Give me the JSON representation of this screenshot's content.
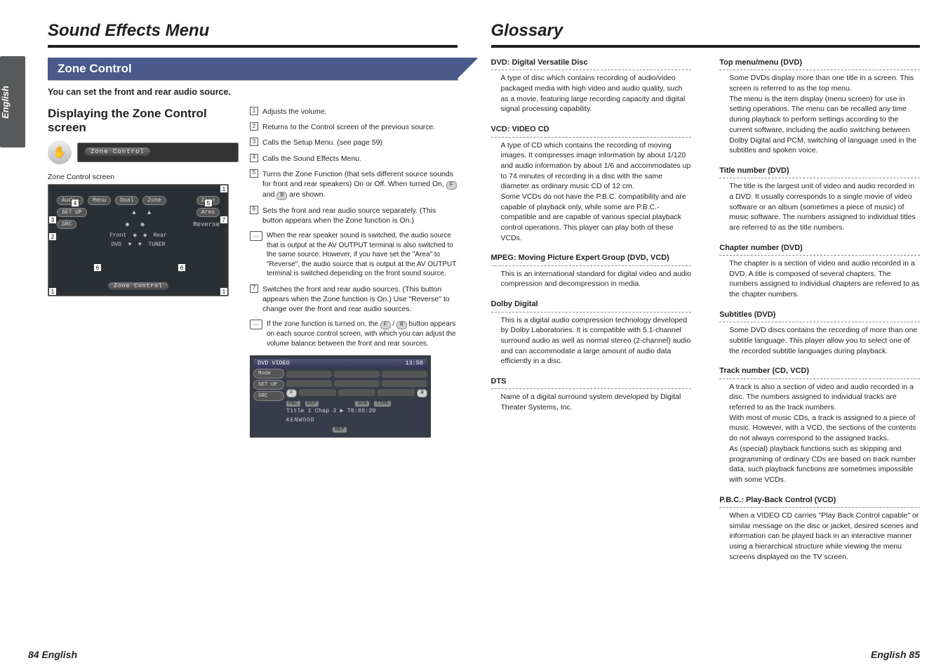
{
  "left": {
    "side_tab": "English",
    "title": "Sound Effects Menu",
    "section_banner": "Zone Control",
    "lead": "You can set the front and rear audio source.",
    "subheading": "Displaying the Zone Control screen",
    "small_screen_title": "Zone   Control",
    "screen_label": "Zone Control screen",
    "zc_screen": {
      "menu": "Menu",
      "dual": "Dual",
      "zone_lbl": "Zone",
      "zone_btn": "Zone",
      "area": "Area",
      "reverse": "Reverse",
      "front": "Front",
      "rear": "Rear",
      "dvd": "DVD",
      "tuner": "TUNER",
      "audio": "Audio",
      "setup_btn": "SET UP",
      "src_btn": "SRC",
      "footer": "Zone   Control"
    },
    "numbered": [
      "Adjusts the volume.",
      "Returns to the Control screen of the previous source.",
      "Calls the Setup Menu. (see page 59)",
      "Calls the Sound Effects Menu.",
      "Turns the Zone Function (that sets different source sounds for front and rear speakers) On or Off. When turned On, [F] and [R] are shown.",
      "Sets the front and rear audio source separately. (This button appears when the Zone function is On.)",
      "Switches the front and rear audio sources. (This button appears when the Zone function is On.) Use \"Reverse\" to change over the front and rear audio sources."
    ],
    "note6": "When the rear speaker sound is switched, the audio source that is output at the AV OUTPUT terminal is also switched to the same source. However, if you have set the \"Area\" to \"Reverse\", the audio source that is output at the AV OUTPUT terminal is switched depending on the front sound source.",
    "note7": "If the zone function is turned on, the [F] / [R] button appears on each source control screen, with which you can adjust the volume balance between the front and rear sources.",
    "dvd_screen": {
      "top_left": "DVD  VIDEO",
      "top_right": "13:50",
      "tags": [
        "PBC",
        "REP",
        "SCN",
        "TIME"
      ],
      "line": "Title 1    Chap    3   ▶   T0:05:20",
      "brand": "KENWOOD",
      "footer_tag": "REP",
      "side1": "Mode",
      "side2": "SET UP",
      "side3": "SRC"
    },
    "pagenum": "84 English"
  },
  "right": {
    "title": "Glossary",
    "col1": [
      {
        "term": "DVD: Digital Versatile Disc",
        "def": "A type of disc which contains recording of audio/video packaged media with high video and audio quality, such as a movie, featuring large recording capacity and digital signal processing capability."
      },
      {
        "term": "VCD: VIDEO CD",
        "def": "A type of CD which contains the recording of moving images. It compresses image information by about 1/120 and audio information by about 1/6 and accommodates up to 74 minutes of recording in a disc with the same diameter as ordinary music CD of 12 cm.\nSome VCDs do not have the P.B.C. compatibility and are capable of playback only, while some are P.B.C.-compatible and are capable of various special playback control operations. This player can play both of these VCDs."
      },
      {
        "term": "MPEG: Moving Picture Expert Group  (DVD, VCD)",
        "def": "This is an international standard for digital video and audio compression and decompression in media."
      },
      {
        "term": "Dolby Digital",
        "def": "This is a digital audio compression technology developed by Dolby Laboratories. It is compatible with 5.1-channel surround audio as well as normal stereo (2-channel) audio and can accommodate a large amount of audio data efficiently in a disc."
      },
      {
        "term": "DTS",
        "def": "Name of a digital surround system developed by Digital Theater Systems, Inc."
      }
    ],
    "col2": [
      {
        "term": "Top menu/menu (DVD)",
        "def": "Some DVDs display more than one title in a screen. This screen is referred to as the top menu.\nThe menu is the item display (menu screen) for use in setting operations. The menu can be recalled any time during playback to perform settings according to the current software, including the audio switching between Dolby Digital and PCM, switching of language used in the subtitles and spoken voice."
      },
      {
        "term": "Title number (DVD)",
        "def": "The title is the largest unit of video and audio recorded in a DVD. It usually corresponds to a single movie of video software or an album (sometimes a piece of music) of music software. The numbers assigned to individual titles are referred to as the title numbers."
      },
      {
        "term": "Chapter number (DVD)",
        "def": "The chapter is a section of video and audio recorded in a DVD. A title is composed of several chapters. The numbers assigned to individual chapters are referred to as the chapter numbers."
      },
      {
        "term": "Subtitles (DVD)",
        "def": "Some DVD discs contains the recording of more than one subtitle language. This player allow you to select one of the recorded subtitle languages during playback."
      },
      {
        "term": "Track number (CD, VCD)",
        "def": "A track is also a section of video and audio recorded in a disc. The numbers assigned to individual tracks are referred to as the track numbers.\nWith most of music CDs, a track is assigned to a piece of music. However, with a VCD, the sections of the contents do not always correspond to the assigned tracks.\nAs (special) playback functions such as skipping and programming of ordinary CDs are based on track number data, such playback functions are sometimes impossible with some VCDs."
      },
      {
        "term": "P.B.C.: Play-Back Control (VCD)",
        "def": "When a VIDEO CD carries \"Play Back Control capable\" or similar message on the disc or jacket, desired scenes and information can be played back in an interactive manner using a hierarchical structure while viewing the menu screens displayed on the TV screen."
      }
    ],
    "pagenum": "English 85"
  }
}
